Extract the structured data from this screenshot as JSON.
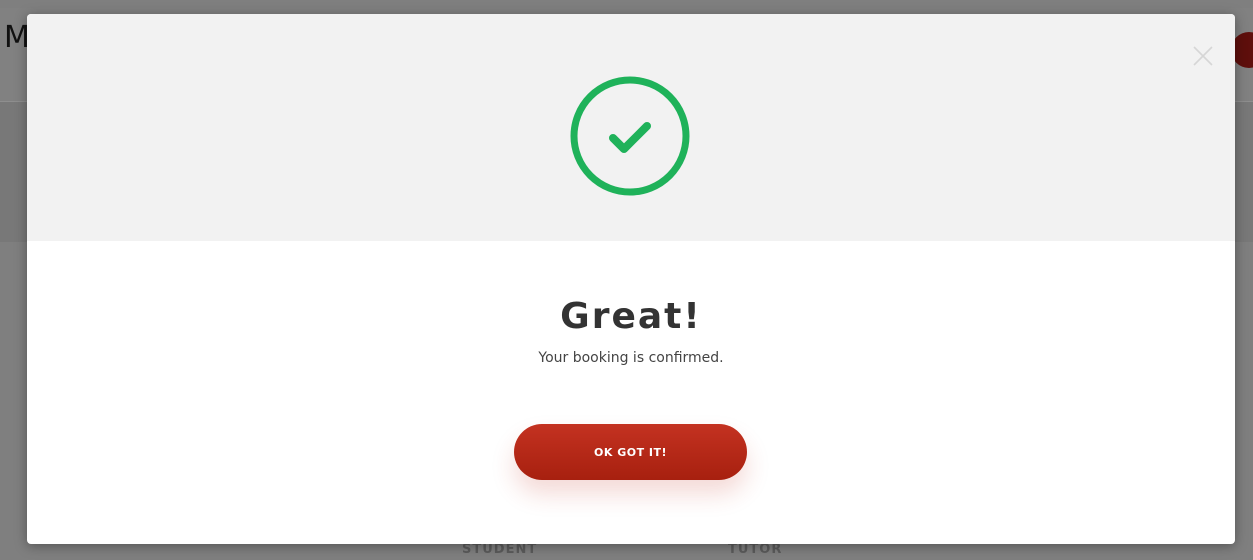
{
  "background": {
    "logo_letter": "M",
    "columns": [
      "STUDENT",
      "TUTOR"
    ]
  },
  "modal": {
    "title": "Great!",
    "message": "Your booking is confirmed.",
    "button_label": "OK GOT IT!",
    "icons": {
      "status": "check-circle-icon",
      "close": "close-icon"
    },
    "colors": {
      "success": "#1fb25a",
      "button": "#b8291a",
      "top_panel": "#f2f2f2"
    }
  }
}
